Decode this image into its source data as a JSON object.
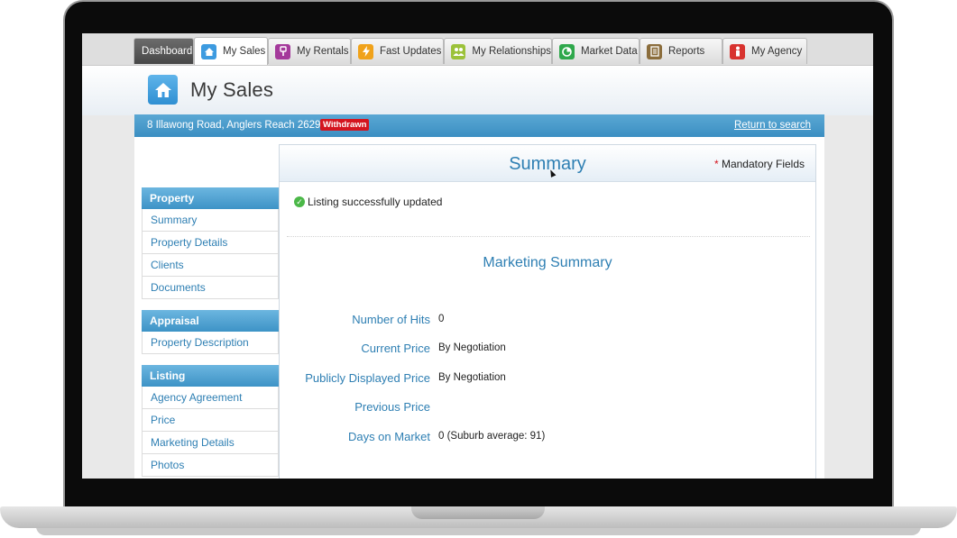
{
  "tabs": [
    {
      "label": "Dashboard",
      "icon": "",
      "color": ""
    },
    {
      "label": "My Sales",
      "icon": "house-icon",
      "color": "#3d9be0"
    },
    {
      "label": "My Rentals",
      "icon": "key-icon",
      "color": "#a4399b"
    },
    {
      "label": "Fast Updates",
      "icon": "lightning-icon",
      "color": "#f0a21a"
    },
    {
      "label": "My Relationships",
      "icon": "people-icon",
      "color": "#9cc23a"
    },
    {
      "label": "Market Data",
      "icon": "pie-chart-icon",
      "color": "#2fa84c"
    },
    {
      "label": "Reports",
      "icon": "document-icon",
      "color": "#8b6d3c"
    },
    {
      "label": "My Agency",
      "icon": "person-icon",
      "color": "#d8332f"
    }
  ],
  "header": {
    "title": "My Sales"
  },
  "address_bar": {
    "address": "8 Illawong Road, Anglers Reach 2629",
    "status": "Withdrawn",
    "return_link": "Return to search"
  },
  "sidebar": {
    "sections": [
      {
        "title": "Property",
        "items": [
          "Summary",
          "Property Details",
          "Clients",
          "Documents"
        ]
      },
      {
        "title": "Appraisal",
        "items": [
          "Property Description"
        ]
      },
      {
        "title": "Listing",
        "items": [
          "Agency Agreement",
          "Price",
          "Marketing Details",
          "Photos"
        ]
      }
    ]
  },
  "summary": {
    "title": "Summary",
    "mandatory_star": "*",
    "mandatory_label": "Mandatory Fields",
    "success_message": "Listing successfully updated",
    "marketing_title": "Marketing Summary",
    "rows": [
      {
        "label": "Number of Hits",
        "value": "0"
      },
      {
        "label": "Current Price",
        "value": "By Negotiation"
      },
      {
        "label": "Publicly Displayed Price",
        "value": "By Negotiation"
      },
      {
        "label": "Previous Price",
        "value": ""
      },
      {
        "label": "Days on Market",
        "value": "0 (Suburb average: 91)"
      }
    ]
  }
}
